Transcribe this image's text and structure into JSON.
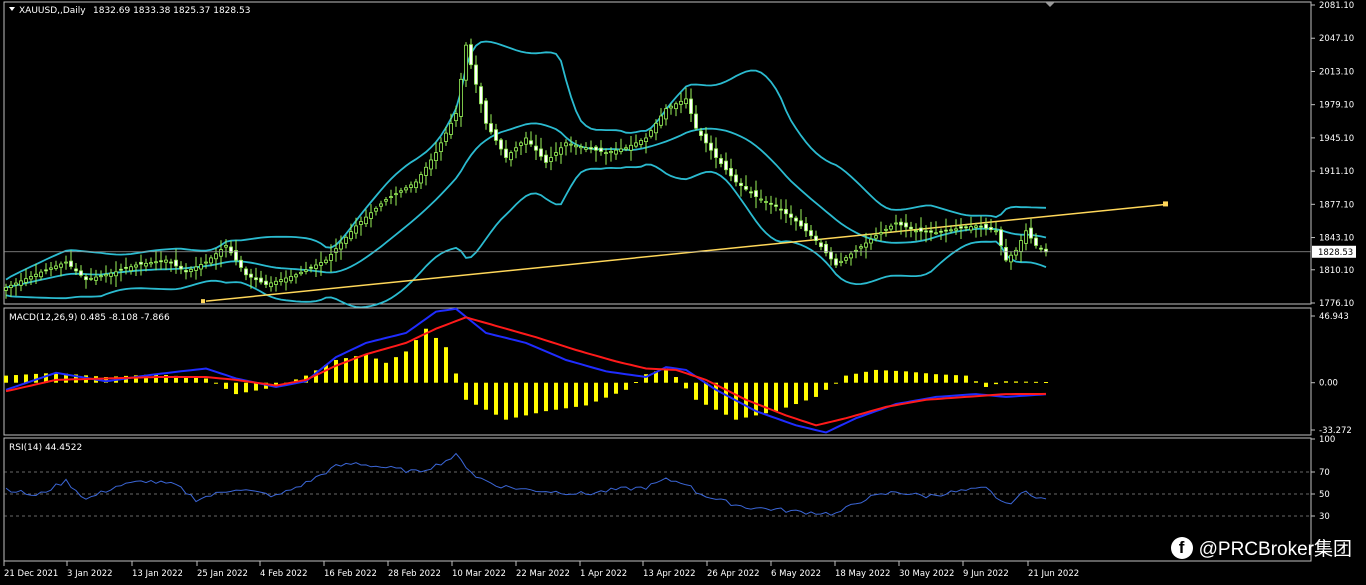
{
  "colors": {
    "background": "#000000",
    "grid": "#c0c0c0",
    "candle": "#9af55a",
    "bands": "#2bbbd0",
    "trendline": "#ffd75a",
    "macd_hist": "#fffb00",
    "macd_line": "#1f2cff",
    "signal_line": "#ff1a1a",
    "rsi_line": "#3b66d6"
  },
  "watermark": {
    "icon": "facebook-icon",
    "text": "@PRCBroker集团"
  },
  "chart_data": [
    {
      "type": "candlestick",
      "title": "XAUUSD,,Daily",
      "ohlc_label": "1832.69 1833.38 1825.37 1828.53",
      "current_price_label": "1828.53",
      "current_price": 1828.53,
      "y_ticks": [
        "2081.10",
        "2047.10",
        "2013.10",
        "1979.10",
        "1945.10",
        "1911.10",
        "1877.10",
        "1843.10",
        "1810.10",
        "1776.10"
      ],
      "ylim": [
        1776.1,
        2081.1
      ],
      "x_tick_labels": [
        "21 Dec 2021",
        "3 Jan 2022",
        "13 Jan 2022",
        "25 Jan 2022",
        "4 Feb 2022",
        "16 Feb 2022",
        "28 Feb 2022",
        "10 Mar 2022",
        "22 Mar 2022",
        "1 Apr 2022",
        "13 Apr 2022",
        "26 Apr 2022",
        "6 May 2022",
        "18 May 2022",
        "30 May 2022",
        "9 Jun 2022",
        "21 Jun 2022"
      ],
      "close_anchors": [
        [
          0,
          1792
        ],
        [
          8,
          1810
        ],
        [
          12,
          1818
        ],
        [
          16,
          1800
        ],
        [
          22,
          1808
        ],
        [
          26,
          1815
        ],
        [
          32,
          1820
        ],
        [
          36,
          1808
        ],
        [
          40,
          1818
        ],
        [
          44,
          1835
        ],
        [
          48,
          1805
        ],
        [
          52,
          1795
        ],
        [
          58,
          1805
        ],
        [
          64,
          1820
        ],
        [
          70,
          1855
        ],
        [
          76,
          1882
        ],
        [
          82,
          1900
        ],
        [
          86,
          1930
        ],
        [
          90,
          1970
        ],
        [
          92,
          2040
        ],
        [
          94,
          2000
        ],
        [
          96,
          1960
        ],
        [
          100,
          1925
        ],
        [
          104,
          1945
        ],
        [
          108,
          1920
        ],
        [
          112,
          1940
        ],
        [
          116,
          1935
        ],
        [
          120,
          1930
        ],
        [
          124,
          1935
        ],
        [
          128,
          1945
        ],
        [
          132,
          1975
        ],
        [
          136,
          1985
        ],
        [
          138,
          1955
        ],
        [
          142,
          1925
        ],
        [
          146,
          1900
        ],
        [
          150,
          1885
        ],
        [
          154,
          1875
        ],
        [
          158,
          1860
        ],
        [
          162,
          1840
        ],
        [
          166,
          1815
        ],
        [
          170,
          1830
        ],
        [
          174,
          1845
        ],
        [
          178,
          1858
        ],
        [
          182,
          1850
        ],
        [
          186,
          1848
        ],
        [
          190,
          1852
        ],
        [
          194,
          1855
        ],
        [
          198,
          1850
        ],
        [
          200,
          1820
        ],
        [
          202,
          1830
        ],
        [
          204,
          1850
        ],
        [
          206,
          1835
        ],
        [
          208,
          1828.53
        ]
      ],
      "trendline_label": "",
      "bollinger": "upper / middle / lower bands"
    },
    {
      "type": "macd",
      "title": "MACD(12,26,9) 0.485 -8.108 -7.866",
      "y_ticks": [
        "46.943",
        "0.00",
        "-33.272"
      ],
      "ylim": [
        -33.272,
        46.943
      ],
      "hist_anchors": [
        [
          0,
          5
        ],
        [
          10,
          7
        ],
        [
          20,
          4
        ],
        [
          30,
          6
        ],
        [
          40,
          3
        ],
        [
          46,
          -8
        ],
        [
          54,
          -3
        ],
        [
          60,
          5
        ],
        [
          66,
          16
        ],
        [
          72,
          20
        ],
        [
          76,
          14
        ],
        [
          80,
          22
        ],
        [
          84,
          38
        ],
        [
          88,
          25
        ],
        [
          92,
          -12
        ],
        [
          100,
          -26
        ],
        [
          108,
          -20
        ],
        [
          116,
          -16
        ],
        [
          124,
          -5
        ],
        [
          128,
          6
        ],
        [
          132,
          10
        ],
        [
          134,
          4
        ],
        [
          138,
          -12
        ],
        [
          146,
          -26
        ],
        [
          154,
          -20
        ],
        [
          162,
          -10
        ],
        [
          168,
          5
        ],
        [
          174,
          9
        ],
        [
          180,
          8
        ],
        [
          186,
          6
        ],
        [
          192,
          5
        ],
        [
          196,
          -3
        ],
        [
          200,
          1
        ],
        [
          208,
          0.5
        ]
      ],
      "macd_anchors": [
        [
          0,
          -5
        ],
        [
          10,
          7
        ],
        [
          20,
          1
        ],
        [
          30,
          6
        ],
        [
          40,
          10
        ],
        [
          46,
          3
        ],
        [
          54,
          -3
        ],
        [
          60,
          1
        ],
        [
          66,
          18
        ],
        [
          72,
          28
        ],
        [
          80,
          35
        ],
        [
          86,
          50
        ],
        [
          90,
          52
        ],
        [
          96,
          35
        ],
        [
          104,
          28
        ],
        [
          112,
          16
        ],
        [
          120,
          8
        ],
        [
          128,
          4
        ],
        [
          132,
          11
        ],
        [
          136,
          9
        ],
        [
          142,
          -5
        ],
        [
          150,
          -20
        ],
        [
          158,
          -30
        ],
        [
          164,
          -35
        ],
        [
          170,
          -25
        ],
        [
          178,
          -15
        ],
        [
          186,
          -10
        ],
        [
          194,
          -8
        ],
        [
          200,
          -10
        ],
        [
          208,
          -8.1
        ]
      ],
      "signal_anchors": [
        [
          0,
          -6
        ],
        [
          10,
          2
        ],
        [
          20,
          3
        ],
        [
          30,
          4
        ],
        [
          40,
          4
        ],
        [
          46,
          2
        ],
        [
          54,
          -2
        ],
        [
          60,
          2
        ],
        [
          66,
          12
        ],
        [
          72,
          20
        ],
        [
          80,
          28
        ],
        [
          86,
          38
        ],
        [
          92,
          46
        ],
        [
          98,
          40
        ],
        [
          106,
          32
        ],
        [
          114,
          23
        ],
        [
          122,
          15
        ],
        [
          128,
          10
        ],
        [
          134,
          9
        ],
        [
          140,
          2
        ],
        [
          148,
          -12
        ],
        [
          156,
          -23
        ],
        [
          162,
          -30
        ],
        [
          168,
          -25
        ],
        [
          176,
          -17
        ],
        [
          184,
          -12
        ],
        [
          192,
          -10
        ],
        [
          200,
          -8
        ],
        [
          208,
          -7.9
        ]
      ]
    },
    {
      "type": "line",
      "title": "RSI(14) 44.4522",
      "y_ticks": [
        "100",
        "70",
        "50",
        "30"
      ],
      "ylim": [
        0,
        100
      ],
      "levels": [
        70,
        50,
        30
      ],
      "anchors": [
        [
          0,
          55
        ],
        [
          6,
          48
        ],
        [
          12,
          62
        ],
        [
          16,
          45
        ],
        [
          22,
          57
        ],
        [
          28,
          62
        ],
        [
          34,
          58
        ],
        [
          38,
          45
        ],
        [
          46,
          55
        ],
        [
          54,
          48
        ],
        [
          60,
          60
        ],
        [
          66,
          75
        ],
        [
          70,
          78
        ],
        [
          76,
          74
        ],
        [
          82,
          70
        ],
        [
          86,
          76
        ],
        [
          90,
          85
        ],
        [
          94,
          66
        ],
        [
          98,
          58
        ],
        [
          104,
          54
        ],
        [
          110,
          52
        ],
        [
          116,
          50
        ],
        [
          122,
          54
        ],
        [
          128,
          56
        ],
        [
          132,
          63
        ],
        [
          136,
          60
        ],
        [
          138,
          52
        ],
        [
          142,
          45
        ],
        [
          148,
          38
        ],
        [
          154,
          36
        ],
        [
          158,
          34
        ],
        [
          162,
          33
        ],
        [
          166,
          32
        ],
        [
          172,
          46
        ],
        [
          178,
          52
        ],
        [
          184,
          48
        ],
        [
          190,
          52
        ],
        [
          196,
          55
        ],
        [
          200,
          40
        ],
        [
          204,
          52
        ],
        [
          208,
          44.45
        ]
      ]
    }
  ]
}
